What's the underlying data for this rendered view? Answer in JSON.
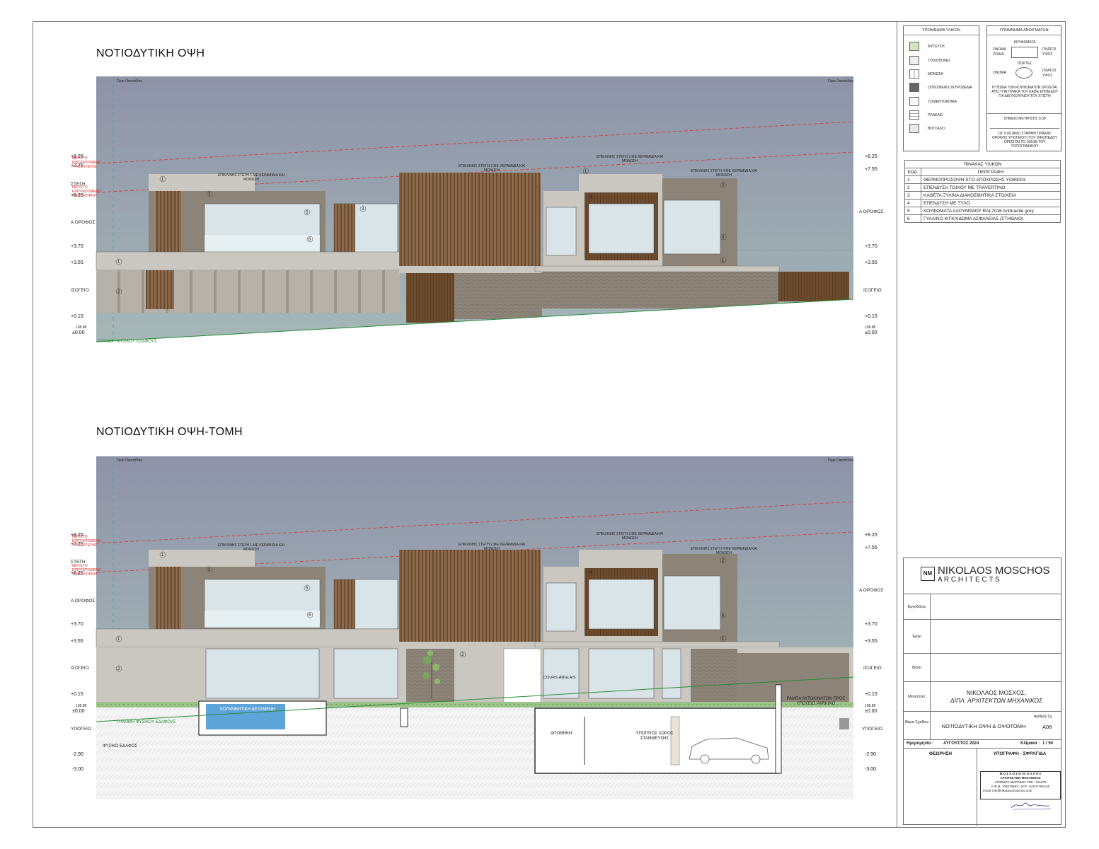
{
  "drawing": {
    "elevation_title": "ΝΟΤΙΟΔΥΤΙΚΗ ΟΨΗ",
    "section_title": "ΝΟΤΙΟΔΥΤΙΚΗ ΟΨΗ-ΤΟΜΗ",
    "property_line_label": "Όριο Οικοπέδου",
    "ground_line_label": "ΓΡΑΜΜΗ ΦΥΣΙΚΟΥ ΕΔΑΦΟΥΣ",
    "natural_ground_label": "ΦΥΣΙΚΟ ΕΔΑΦΟΣ",
    "max_height_note_1": "ΜΕΓΙΣΤΟ ΕΠΙΤΡΕΠΟΜΕΝΟ ΥΨΟΣ ΣΤΕΓΗΣ",
    "max_height_note_2": "ΜΕΓΙΣΤΟ ΕΠΙΤΡΕΠΟΜΕΝΟ ΥΨΟΣ ΚΤΙΡΙΟΥ",
    "levels": {
      "l825": "+8.25",
      "l775": "+7.75",
      "l755": "+7.55",
      "l625": "+6.25",
      "l370": "+3.70",
      "l355": "+3.55",
      "l015": "+0.15",
      "l000": "±0.00",
      "l10888": "108.88",
      "lm290": "-2.90",
      "lm300": "-3.00"
    },
    "floors": {
      "roof": "ΣΤΕΓΗ",
      "first": "Α ΟΡΟΦΟΣ",
      "ground": "ΙΣΟΓΕΙΟ",
      "basement": "ΥΠΟΓΕΙΟ"
    },
    "roofs": [
      "ΕΠΙΚΛΙΝΗΣ ΣΤΕΓΗ 1 ΜΕ ΚΕΡΑΜΙΔΙΑ ΚΑΙ ΜΟΝΩΣΗ",
      "ΕΠΙΚΛΙΝΗΣ ΣΤΕΓΗ 2 ΜΕ ΚΕΡΑΜΙΔΙΑ ΚΑΙ ΜΟΝΩΣΗ",
      "ΕΠΙΚΛΙΝΗΣ ΣΤΕΓΗ 3 ΜΕ ΚΕΡΑΜΙΔΙΑ ΚΑΙ ΜΟΝΩΣΗ",
      "ΕΠΙΚΛΙΝΗΣ ΣΤΕΓΗ 4 ΜΕ ΚΕΡΑΜΙΔΙΑ ΚΑΙ ΜΟΝΩΣΗ"
    ],
    "section_labels": {
      "pool": "ΚΟΛΥΜΒΗΤΙΚΗ ΔΕΞΑΜΕΝΗ",
      "storage": "ΑΠΟΘΗΚΗ",
      "parking": "ΥΠΟΓΕΙΟΣ ΧΩΡΟΣ ΣΤΑΘΜΕΥΣΗΣ",
      "ramp": "ΡΑΜΠΑ ΑΥΤΟΚΙΝΗΤΩΝ ΠΡΟΣ ΥΠΟΓΕΙΟ PARKING",
      "cours": "COURS-ANGLAIS"
    }
  },
  "legend_materials": {
    "title": "ΥΠΟΜΝΗΜΑ ΥΛΙΚΩΝ",
    "items": [
      "ΦΥΤΕΥΣΗ",
      "ΤΟΙΧΟΠΟΙΙΕΣ",
      "ΜΟΝΩΣΗ",
      "ΟΠΛΙΣΜΕΝΟ ΣΚΥΡΟΔΕΜΑ",
      "ΤΣΙΜΕΝΤΟΚΟΝΙΑ",
      "ΠΛΑΚΑΚΙ",
      "ΒΟΤΣΑΛΟ"
    ]
  },
  "legend_openings": {
    "title": "ΥΠΟΜΝΗΜΑ ΑΝΟΙΓΜΑΤΩΝ",
    "windows": "ΚΟΥΦΩΜΑΤΑ",
    "doors": "ΠΟΡΤΕΣ",
    "name": "ΟΝΟΜΑ",
    "podia": "ΠΟΔΙΑ",
    "width": "ΠΛΑΤΟΣ",
    "height": "ΥΨΟΣ",
    "note1": "Η ΠΟΔΙΑ ΤΩΝ ΚΟΥΦΩΜΑΤΩΝ ΟΡΙΖΕΤΑΙ ΑΠΟ ΤΗΝ ΠΛΑΚΑ ΤΟΥ ΚΑΘΕ ΕΠΙΠΕΔΟΥ ΓΙΑ ΔΙΕΥΚΟΛΥΝΣΗ ΤΟΥ ΧΤΙΣΤΗ",
    "note2": "ΣΗΜΕΙΟ ΜΕΤΡΗΣΗΣ 0.00",
    "note3": "ΩΣ 0.00 (ΑΝΩ ΣΤΑΘΜΗ ΠΛΑΚΑΣ ΟΡΟΦΗΣ ΥΠΟΓΕΙΟΥ) ΤΟΥ ΟΙΚΟΠΕΔΟΥ ΟΡΙΖΕΤΑΙ ΤΟ 108.88 ΤΟΥ ΤΟΠΟΓΡΑΦΙΚΟΥ"
  },
  "materials_table": {
    "title": "ΠΙΝΑΚΑΣ ΥΛΙΚΩΝ",
    "col_code": "ΚΩΔ.",
    "col_desc": "ΠΕΡΙΓΡΑΦΗ",
    "rows": [
      {
        "code": "1",
        "desc": "ΘΕΡΜΟΠΡΟΣΟΨΗ  STO ΑΠΟΧΡΩΣΗΣ YO89003"
      },
      {
        "code": "2",
        "desc": "ΕΠΕΝΔΥΣΗ ΤΟΙΧΟΥ ΜΕ TRAVERTINO"
      },
      {
        "code": "3",
        "desc": "ΚΑΘΕΤΑ ΞΥΛΙΝΑ ΔΙΑΚΟΣΜΗΤΙΚΑ ΣΤΟΙΧΕΙΑ"
      },
      {
        "code": "4",
        "desc": "ΕΠΕΝΔΥΣΗ ΜΕ ΞΥΛΟ"
      },
      {
        "code": "5",
        "desc": "ΚΟΥΦΩΜΑΤΑ ΑΛΟΥΜΙΝΙΟΥ RAL7016 Anthracite grey"
      },
      {
        "code": "6",
        "desc": "ΓΥΑΛΙΝΟ ΚΙΓΚΛΙΔΩΜΑ ΑΣΦΑΛΕΙΑΣ (ΣΤΗΘΑΙΟ)"
      }
    ]
  },
  "title_block": {
    "firm_line1": "NIKOLAOS MOSCHOS",
    "firm_line2": "A R C H I T E C T S",
    "logo_letters": "NM",
    "client_label": "Εργοδότες",
    "project_label": "Έργο",
    "location_label": "Θέση",
    "designers_label": "Μελετητές",
    "designer_name": "ΝΙΚΟΛΑΟΣ ΜΟΣΧΟΣ,",
    "designer_title": "ΔΙΠΛ. ΑΡΧΙΤΕΚΤΩΝ ΜΗΧΑΝΙΚΟΣ",
    "subject_label": "Θέμα Σχεδίου",
    "subject": "ΝΟΤΙΟΔΥΤΙΚΗ ΟΨΗ & ΟΨΟΤΟΜΗ",
    "drawing_no_label": "Αριθμός Σχ.",
    "drawing_no": "Α08",
    "date_label": "Ημερομηνία :",
    "date": "ΑΥΓΟΥΣΤΟΣ 2024",
    "scale_label": "Κλίμακα :",
    "scale": "1 / 50",
    "review_label": "ΘΕΩΡΗΣΗ",
    "sign_label": "ΥΠΟΓΡΑΦΗ - ΣΦΡΑΓΙΔΑ",
    "stamp_line1": "Μ Ο Σ Χ Ο Σ   Ν Ι Κ Ο Λ Α Ο Σ",
    "stamp_line2": "ΑΡΧΙΤΕΚΤΩΝ ΜΗΧΑΝΙΚΟΣ",
    "stamp_line3": "ΑΡΙΘΜΟΣ ΜΗΤΡΩΟΥ ΤΕΕ : 121670",
    "stamp_line4": "Α.Φ.Μ. 106576883 - ΔΟΥ: ΗΛΙΟΥΠΟΛΗΣ",
    "stamp_line5": "email: info@nikolaosmoschos.com"
  },
  "colors": {
    "sky_top": "#8e95a8",
    "sky_bottom": "#9eb0b3",
    "facade": "#c9c7c0",
    "travertine": "#8d8479",
    "wood": "#7a5a3a",
    "glass": "#d7e6ec",
    "ground_line": "#2a8a3a",
    "limit_line": "#d63a3a"
  }
}
